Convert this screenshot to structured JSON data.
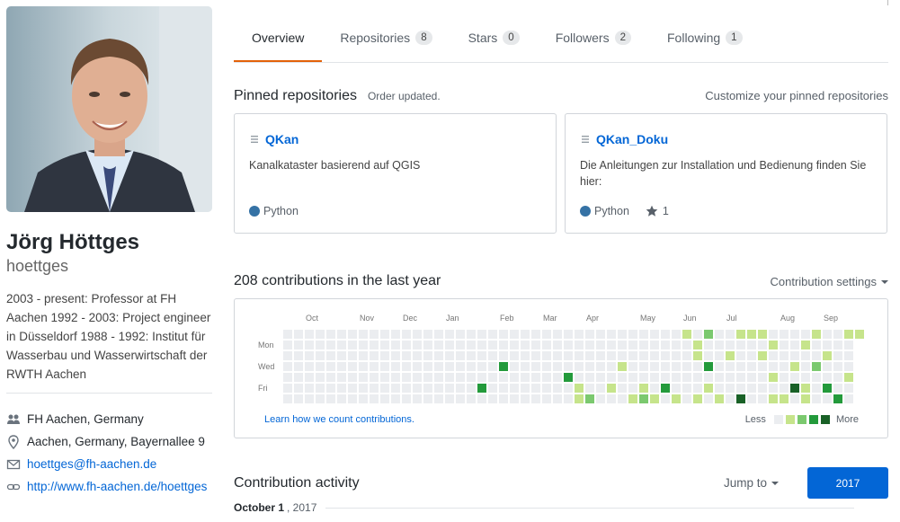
{
  "profile": {
    "fullname": "Jörg Höttges",
    "login": "hoettges",
    "bio": "2003 - present: Professor at FH Aachen 1992 - 2003: Project engineer in Düsseldorf 1988 - 1992: Institut für Wasserbau und Wasserwirtschaft der RWTH Aachen",
    "organization": "FH Aachen, Germany",
    "location": "Aachen, Germany, Bayernallee 9",
    "email": "hoettges@fh-aachen.de",
    "website": "http://www.fh-aachen.de/hoettges",
    "icons": [
      "people-icon",
      "location-icon",
      "mail-icon",
      "link-icon"
    ]
  },
  "tabs": [
    {
      "label": "Overview",
      "count": null,
      "selected": true
    },
    {
      "label": "Repositories",
      "count": "8"
    },
    {
      "label": "Stars",
      "count": "0"
    },
    {
      "label": "Followers",
      "count": "2"
    },
    {
      "label": "Following",
      "count": "1"
    }
  ],
  "pinned": {
    "title": "Pinned repositories",
    "note": "Order updated.",
    "customize": "Customize your pinned repositories",
    "repos": [
      {
        "name": "QKan",
        "description": "Kanalkataster basierend auf QGIS",
        "language": "Python",
        "language_color": "#3572A5",
        "stars": null
      },
      {
        "name": "QKan_Doku",
        "description": "Die Anleitungen zur Installation und Bedienung finden Sie hier:",
        "language": "Python",
        "language_color": "#3572A5",
        "stars": "1"
      }
    ]
  },
  "contributions": {
    "title": "208 contributions in the last year",
    "settings": "Contribution settings",
    "months": [
      "Oct",
      "Nov",
      "Dec",
      "Jan",
      "Feb",
      "Mar",
      "Apr",
      "May",
      "Jun",
      "Jul",
      "Aug",
      "Sep"
    ],
    "days": [
      "Mon",
      "Wed",
      "Fri"
    ],
    "learn": "Learn how we count contributions.",
    "less": "Less",
    "more": "More",
    "palette": [
      "#ebedf0",
      "#c6e48b",
      "#7bc96f",
      "#239a3b",
      "#196127"
    ]
  },
  "activity": {
    "title": "Contribution activity",
    "jump": "Jump to",
    "year": "2017",
    "date": "October 1",
    "date_year": ", 2017"
  }
}
